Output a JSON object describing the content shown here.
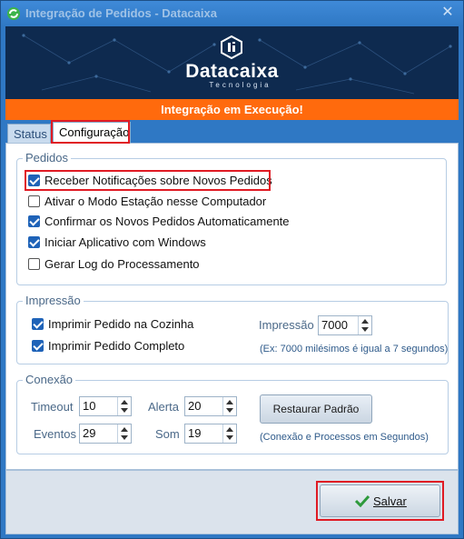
{
  "window": {
    "title": "Integração de Pedidos - Datacaixa",
    "close_glyph": "✕"
  },
  "banner": {
    "brand": "Datacaixa",
    "tagline": "Tecnologia"
  },
  "status": {
    "text": "Integração em Execução!",
    "color": "#ff6a0d"
  },
  "tabs": [
    {
      "label": "Status",
      "active": false
    },
    {
      "label": "Configuração",
      "active": true
    }
  ],
  "pedidos": {
    "legend": "Pedidos",
    "options": [
      {
        "label": "Receber Notificações sobre Novos Pedidos",
        "checked": true
      },
      {
        "label": "Ativar o Modo Estação nesse Computador",
        "checked": false
      },
      {
        "label": "Confirmar os Novos Pedidos Automaticamente",
        "checked": true
      },
      {
        "label": "Iniciar Aplicativo com Windows",
        "checked": true
      },
      {
        "label": "Gerar Log do Processamento",
        "checked": false
      }
    ]
  },
  "impressao": {
    "legend": "Impressão",
    "options": [
      {
        "label": "Imprimir Pedido na Cozinha",
        "checked": true
      },
      {
        "label": "Imprimir Pedido Completo",
        "checked": true
      }
    ],
    "delay_label": "Impressão",
    "delay_value": "7000",
    "note": "(Ex: 7000 milésimos é igual a 7 segundos)"
  },
  "conexao": {
    "legend": "Conexão",
    "timeout_label": "Timeout",
    "timeout_value": "10",
    "eventos_label": "Eventos",
    "eventos_value": "29",
    "alerta_label": "Alerta",
    "alerta_value": "20",
    "som_label": "Som",
    "som_value": "19",
    "restore_label": "Restaurar Padrão",
    "note": "(Conexão e Processos em Segundos)"
  },
  "footer": {
    "save_label": "Salvar"
  },
  "colors": {
    "accent": "#1f63b8",
    "highlight": "#e01b24"
  }
}
